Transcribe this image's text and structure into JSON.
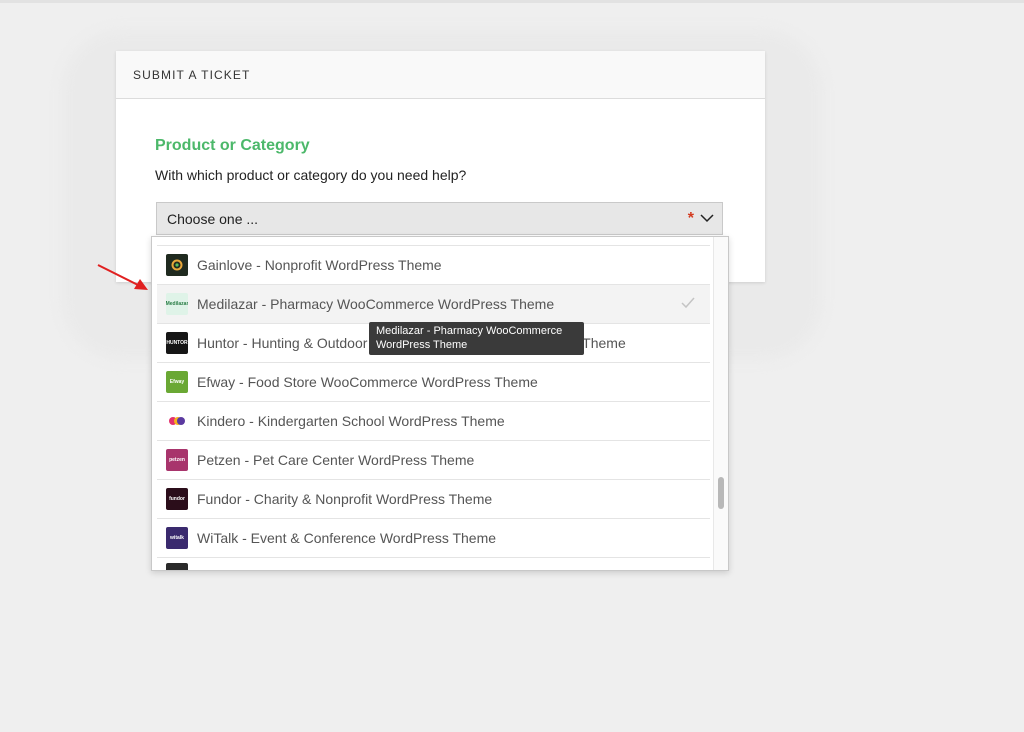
{
  "panel": {
    "header": "SUBMIT A TICKET",
    "section_title": "Product or Category",
    "section_desc": "With which product or category do you need help?",
    "select_placeholder": "Choose one ...",
    "required_mark": "*"
  },
  "dropdown": {
    "items": [
      {
        "label": "Gainlove - Nonprofit WordPress Theme",
        "thumb_color": "#1f2a1f",
        "icon": "gainlove-logo-icon",
        "thumb_text": ""
      },
      {
        "label": "Medilazar - Pharmacy WooCommerce WordPress Theme",
        "thumb_color": "#dff3e8",
        "icon": "medilazar-logo-icon",
        "thumb_text": "Medilazar",
        "selected": true
      },
      {
        "label": "Huntor - Hunting & Outdoor Store WooCommerce WordPress Theme",
        "thumb_color": "#161616",
        "icon": "huntor-logo-icon",
        "thumb_text": "HUNTOR"
      },
      {
        "label": "Efway - Food Store WooCommerce WordPress Theme",
        "thumb_color": "#6aa834",
        "icon": "efway-logo-icon",
        "thumb_text": "Efway"
      },
      {
        "label": "Kindero - Kindergarten School WordPress Theme",
        "thumb_color": "#ffffff",
        "icon": "kindero-logo-icon",
        "thumb_text": ""
      },
      {
        "label": "Petzen - Pet Care Center WordPress Theme",
        "thumb_color": "#a8346c",
        "icon": "petzen-logo-icon",
        "thumb_text": "petzen"
      },
      {
        "label": "Fundor - Charity & Nonprofit WordPress Theme",
        "thumb_color": "#2b0d1a",
        "icon": "fundor-logo-icon",
        "thumb_text": "fundor"
      },
      {
        "label": "WiTalk - Event & Conference WordPress Theme",
        "thumb_color": "#3a2a6e",
        "icon": "witalk-logo-icon",
        "thumb_text": "witalk"
      }
    ],
    "tooltip": "Medilazar - Pharmacy WooCommerce WordPress Theme"
  },
  "colors": {
    "accent_green": "#4cb86a",
    "required_red": "#d33a1f",
    "annotation_arrow": "#e02020"
  }
}
